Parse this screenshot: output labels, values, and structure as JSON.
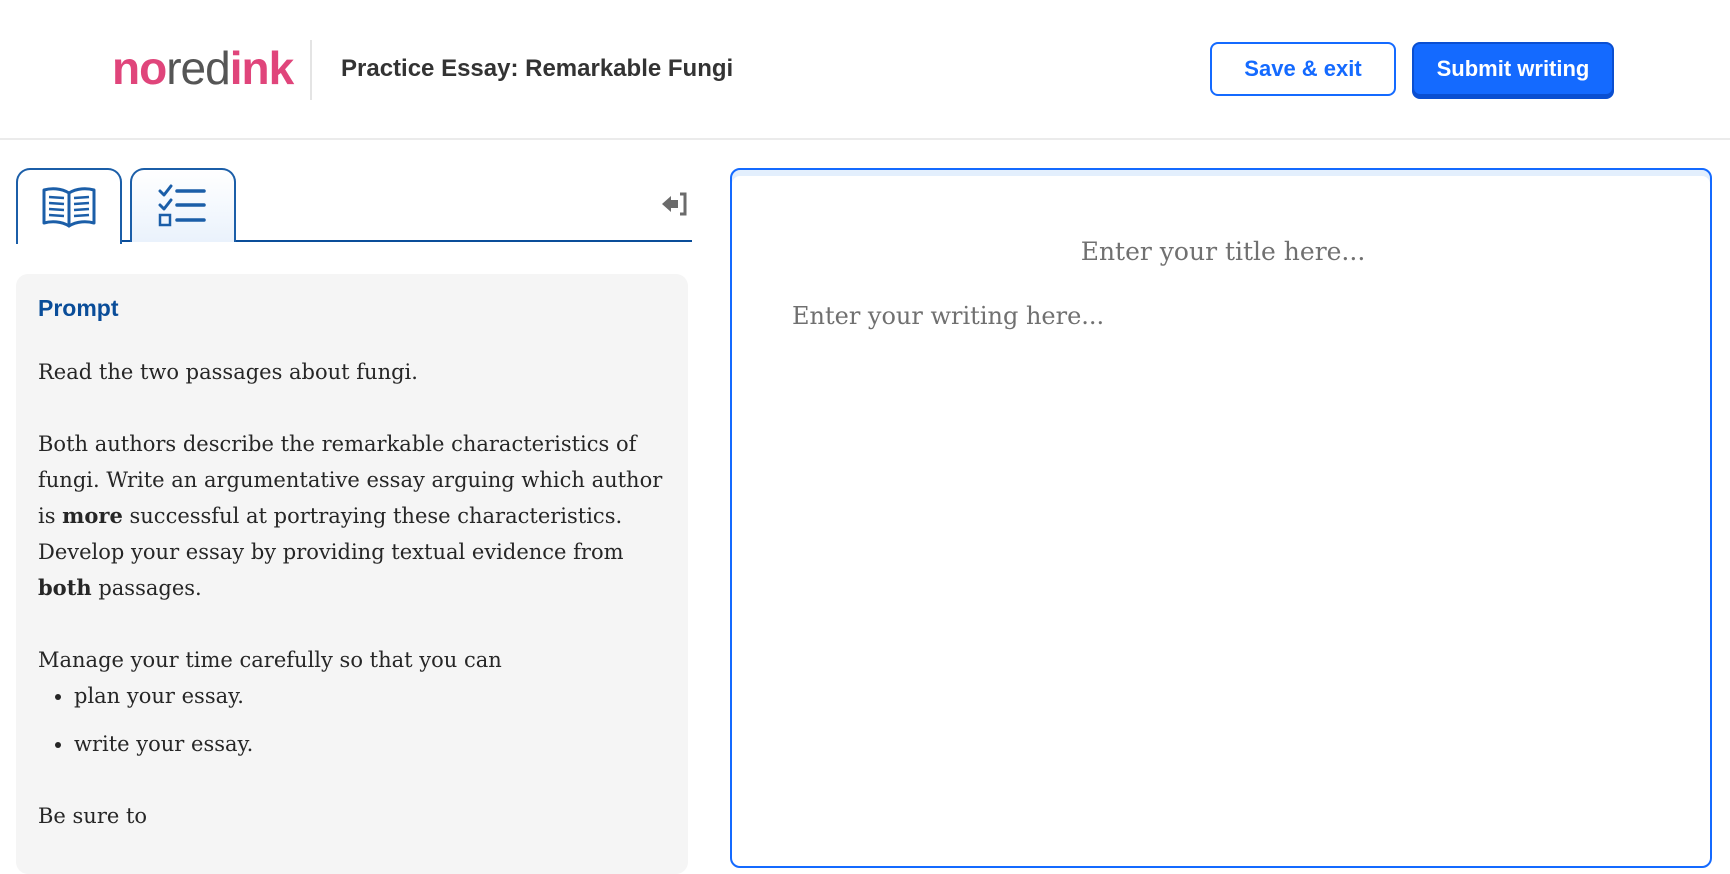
{
  "header": {
    "logo": {
      "part1": "no",
      "part2": "red",
      "part3": "ink"
    },
    "title": "Practice Essay: Remarkable Fungi",
    "save_label": "Save & exit",
    "submit_label": "Submit writing"
  },
  "sidebar": {
    "tabs": [
      {
        "icon": "open-book-icon",
        "active": true
      },
      {
        "icon": "checklist-icon",
        "active": false
      }
    ],
    "collapse_icon": "collapse-panel-icon",
    "prompt": {
      "heading": "Prompt",
      "p1": "Read the two passages about fungi.",
      "p2_a": "Both authors describe the remarkable characteristics of fungi. Write an argumentative essay arguing which author is ",
      "p2_bold1": "more",
      "p2_b": " successful at portraying these characteristics. Develop your essay by providing textual evidence from ",
      "p2_bold2": "both",
      "p2_c": " passages.",
      "p3": "Manage your time carefully so that you can",
      "bullets": [
        "plan your essay.",
        "write your essay."
      ],
      "p4": "Be sure to"
    }
  },
  "editor": {
    "title_placeholder": "Enter your title here...",
    "body_placeholder": "Enter your writing here...",
    "title_value": "",
    "body_value": ""
  },
  "colors": {
    "brand_pink": "#e0457b",
    "primary_blue": "#146aff",
    "navy": "#0a4d99"
  }
}
